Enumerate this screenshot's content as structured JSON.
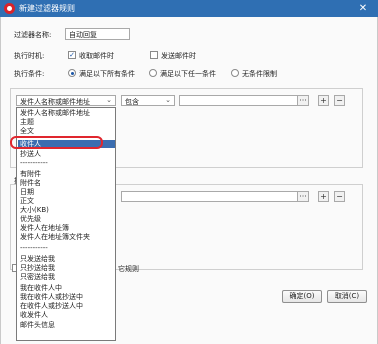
{
  "window": {
    "title": "新建过滤器规则",
    "close_glyph": "✕"
  },
  "form": {
    "name_label": "过滤器名称:",
    "name_value": "自动回复",
    "timing_label": "执行时机:",
    "timing_receive": "收取邮件时",
    "timing_send": "发送邮件时",
    "condition_label": "执行条件:",
    "cond_all": "满足以下所有条件",
    "cond_any": "满足以下任一条件",
    "cond_none": "无条件限制"
  },
  "rule": {
    "field_select": "发件人名称或邮件地址",
    "op_select": "包含",
    "ellipsis": "···",
    "plus": "+",
    "minus": "−"
  },
  "dropdown": {
    "items": [
      "发件人名称或邮件地址",
      "主题",
      "全文",
      "收件人",
      "抄送人",
      "-----------",
      "有附件",
      "附件名",
      "日期",
      "正文",
      "大小(KB)",
      "优先级",
      "发件人在地址簿",
      "发件人在地址簿文件夹",
      "-----------",
      "只发送给我",
      "只抄送给我",
      "只密送给我",
      "我在收件人中",
      "我在收件人或抄送中",
      "在收件人或抄送人中",
      "收发件人",
      "邮件头信息"
    ],
    "selected_index": 3
  },
  "partial": {
    "section_glyph": "执",
    "other_rules": "它规则"
  },
  "buttons": {
    "ok": "确定(O)",
    "cancel": "取消(C)"
  },
  "colors": {
    "titlebar": "#2f6fb3",
    "highlight": "#3b6db0",
    "ring": "#e0262e"
  }
}
